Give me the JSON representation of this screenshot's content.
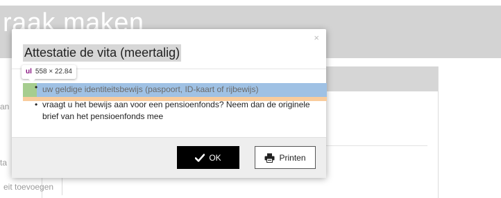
{
  "background": {
    "heading": "raak maken",
    "fragment_1": "an",
    "fragment_2": "ta",
    "add_link": "eit toevoegen"
  },
  "devtools": {
    "tag": "ul",
    "dimensions": "558 × 22.84"
  },
  "modal": {
    "title": "Attestatie de vita (meertalig)",
    "close_symbol": "×",
    "items": [
      "uw geldige identiteitsbewijs (paspoort, ID-kaart of rijbewijs)",
      "vraagt u het bewijs aan voor een pensioenfonds? Neem dan de originele brief van het pensioenfonds mee"
    ],
    "ok_label": "OK",
    "print_label": "Printen"
  },
  "icons": {
    "ok": "checkmark-icon",
    "print": "printer-icon",
    "close": "close-icon"
  },
  "colors": {
    "ok_button_bg": "#000000",
    "highlight_content": "#9fc1e4",
    "highlight_padding": "#a6cd8f",
    "highlight_margin": "#f9cc9d",
    "devtools_tag": "#881280"
  }
}
